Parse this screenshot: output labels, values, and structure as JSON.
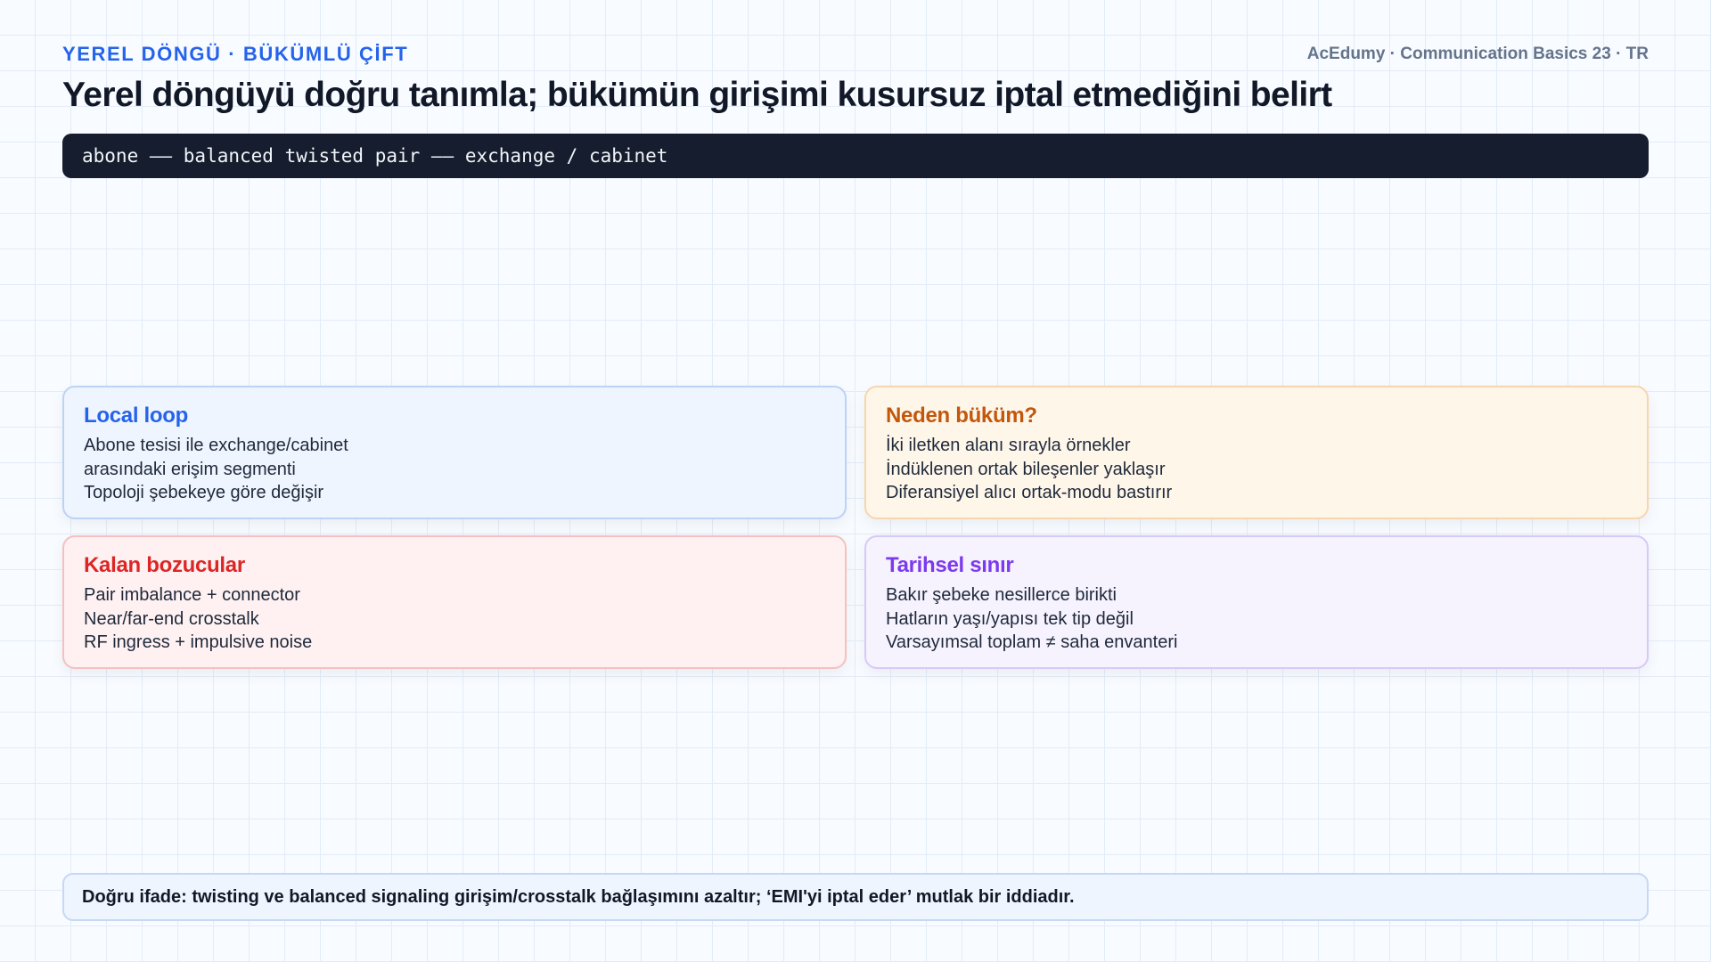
{
  "header": {
    "eyebrow": "YEREL DÖNGÜ · BÜKÜMLÜ ÇİFT",
    "brand": "AcEdumy · Communication Basics 23 · TR"
  },
  "title": "Yerel döngüyü doğru tanımla; bükümün girişimi kusursuz iptal etmediğini belirt",
  "signal_path": "abone —— balanced twisted pair —— exchange / cabinet",
  "cards": [
    {
      "title": "Local loop",
      "accent": "#2563eb",
      "lines": [
        "Abone tesisi ile exchange/cabinet",
        "arasındaki erişim segmenti",
        "Topoloji şebekeye göre değişir"
      ]
    },
    {
      "title": "Neden büküm?",
      "accent": "#c2570c",
      "lines": [
        "İki iletken alanı sırayla örnekler",
        "İndüklenen ortak bileşenler yaklaşır",
        "Diferansiyel alıcı ortak-modu bastırır"
      ]
    },
    {
      "title": "Kalan bozucular",
      "accent": "#dc2626",
      "lines": [
        "Pair imbalance + connector",
        "Near/far-end crosstalk",
        "RF ingress + impulsive noise"
      ]
    },
    {
      "title": "Tarihsel sınır",
      "accent": "#7c3aed",
      "lines": [
        "Bakır şebeke nesillerce birikti",
        "Hatların yaşı/yapısı tek tip değil",
        "Varsayımsal toplam ≠ saha envanteri"
      ]
    }
  ],
  "footer": "Doğru ifade: twisting ve balanced signaling girişim/crosstalk bağlaşımını azaltır; ‘EMI'yi iptal eder’ mutlak bir iddiadır."
}
